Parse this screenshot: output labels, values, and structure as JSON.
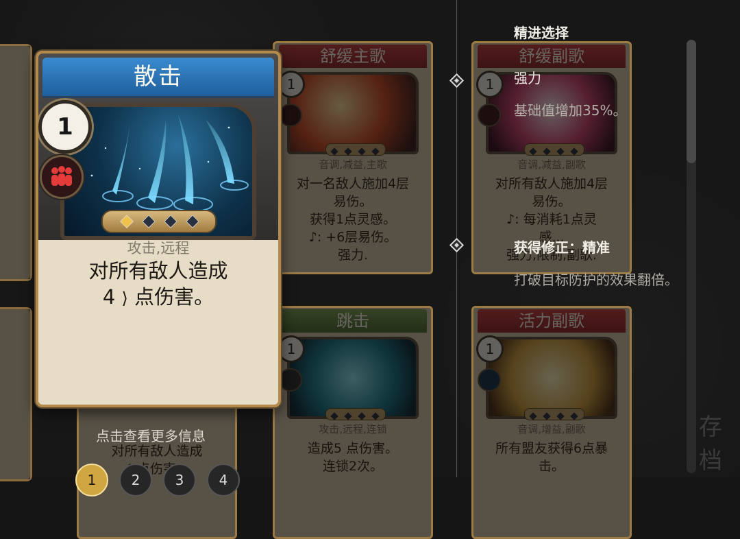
{
  "screen_title": "精进选择",
  "tooltip": {
    "upgrade_name": "强力",
    "upgrade_desc": "基础值增加35%。",
    "modifier_title": "获得修正：精准",
    "modifier_desc": "打破目标防护的效果翻倍。"
  },
  "main_card": {
    "title": "散击",
    "cost": "1",
    "type": "攻击,远程",
    "desc_line1": "对所有敌人造成",
    "desc_value": "4",
    "desc_line2_tail": "点伤害。",
    "gems_lit": 1
  },
  "background_cards": [
    {
      "title": "舒缓主歌",
      "cost": "1",
      "type": "音调,减益,主歌",
      "desc": [
        "对一名敌人施加4层",
        "易伤。",
        "获得1点灵感。",
        "♪: +6层易伤。",
        "强力."
      ]
    },
    {
      "title": "舒缓副歌",
      "cost": "1",
      "type": "音调,减益,副歌",
      "desc": [
        "对所有敌人施加4层",
        "易伤。",
        "♪: 每消耗1点灵",
        "感...",
        "强力,限制,副歌."
      ]
    },
    {
      "title": "跳击",
      "cost": "1",
      "type": "攻击,远程,连锁",
      "desc": [
        "造成5 点伤害。",
        "连锁2次。"
      ]
    },
    {
      "title": "活力副歌",
      "cost": "1",
      "type": "音调,增益,副歌",
      "desc": [
        "所有盟友获得6点暴",
        "击。"
      ]
    }
  ],
  "lower_left_card_desc": [
    "对所有敌人造成",
    "4 点伤害。"
  ],
  "hint": "点击查看更多信息",
  "pager": [
    "1",
    "2",
    "3",
    "4"
  ],
  "pager_active": "1",
  "right_ghost_text": "存档",
  "colors": {
    "main_title_bar": "#2f78bd",
    "red_title_bar": "#b33334",
    "green_title_bar": "#6a8f45",
    "gold_border": "#b58b4d"
  }
}
